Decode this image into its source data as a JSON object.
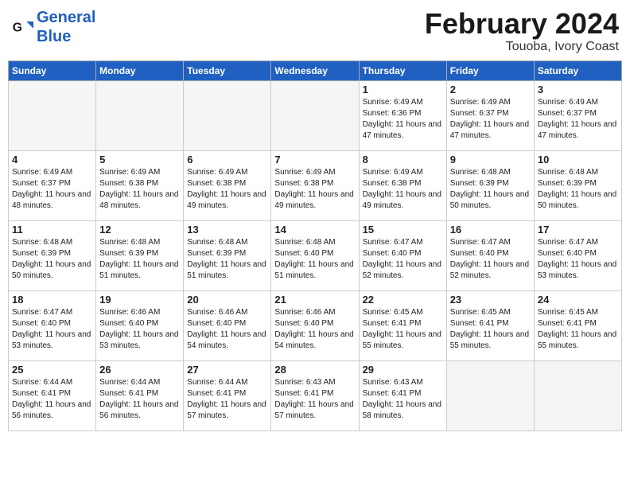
{
  "header": {
    "logo_text_general": "General",
    "logo_text_blue": "Blue",
    "month_year": "February 2024",
    "location": "Touoba, Ivory Coast"
  },
  "weekdays": [
    "Sunday",
    "Monday",
    "Tuesday",
    "Wednesday",
    "Thursday",
    "Friday",
    "Saturday"
  ],
  "weeks": [
    [
      {
        "day": "",
        "empty": true
      },
      {
        "day": "",
        "empty": true
      },
      {
        "day": "",
        "empty": true
      },
      {
        "day": "",
        "empty": true
      },
      {
        "day": "1",
        "sunrise": "Sunrise: 6:49 AM",
        "sunset": "Sunset: 6:36 PM",
        "daylight": "Daylight: 11 hours and 47 minutes."
      },
      {
        "day": "2",
        "sunrise": "Sunrise: 6:49 AM",
        "sunset": "Sunset: 6:37 PM",
        "daylight": "Daylight: 11 hours and 47 minutes."
      },
      {
        "day": "3",
        "sunrise": "Sunrise: 6:49 AM",
        "sunset": "Sunset: 6:37 PM",
        "daylight": "Daylight: 11 hours and 47 minutes."
      }
    ],
    [
      {
        "day": "4",
        "sunrise": "Sunrise: 6:49 AM",
        "sunset": "Sunset: 6:37 PM",
        "daylight": "Daylight: 11 hours and 48 minutes."
      },
      {
        "day": "5",
        "sunrise": "Sunrise: 6:49 AM",
        "sunset": "Sunset: 6:38 PM",
        "daylight": "Daylight: 11 hours and 48 minutes."
      },
      {
        "day": "6",
        "sunrise": "Sunrise: 6:49 AM",
        "sunset": "Sunset: 6:38 PM",
        "daylight": "Daylight: 11 hours and 49 minutes."
      },
      {
        "day": "7",
        "sunrise": "Sunrise: 6:49 AM",
        "sunset": "Sunset: 6:38 PM",
        "daylight": "Daylight: 11 hours and 49 minutes."
      },
      {
        "day": "8",
        "sunrise": "Sunrise: 6:49 AM",
        "sunset": "Sunset: 6:38 PM",
        "daylight": "Daylight: 11 hours and 49 minutes."
      },
      {
        "day": "9",
        "sunrise": "Sunrise: 6:48 AM",
        "sunset": "Sunset: 6:39 PM",
        "daylight": "Daylight: 11 hours and 50 minutes."
      },
      {
        "day": "10",
        "sunrise": "Sunrise: 6:48 AM",
        "sunset": "Sunset: 6:39 PM",
        "daylight": "Daylight: 11 hours and 50 minutes."
      }
    ],
    [
      {
        "day": "11",
        "sunrise": "Sunrise: 6:48 AM",
        "sunset": "Sunset: 6:39 PM",
        "daylight": "Daylight: 11 hours and 50 minutes."
      },
      {
        "day": "12",
        "sunrise": "Sunrise: 6:48 AM",
        "sunset": "Sunset: 6:39 PM",
        "daylight": "Daylight: 11 hours and 51 minutes."
      },
      {
        "day": "13",
        "sunrise": "Sunrise: 6:48 AM",
        "sunset": "Sunset: 6:39 PM",
        "daylight": "Daylight: 11 hours and 51 minutes."
      },
      {
        "day": "14",
        "sunrise": "Sunrise: 6:48 AM",
        "sunset": "Sunset: 6:40 PM",
        "daylight": "Daylight: 11 hours and 51 minutes."
      },
      {
        "day": "15",
        "sunrise": "Sunrise: 6:47 AM",
        "sunset": "Sunset: 6:40 PM",
        "daylight": "Daylight: 11 hours and 52 minutes."
      },
      {
        "day": "16",
        "sunrise": "Sunrise: 6:47 AM",
        "sunset": "Sunset: 6:40 PM",
        "daylight": "Daylight: 11 hours and 52 minutes."
      },
      {
        "day": "17",
        "sunrise": "Sunrise: 6:47 AM",
        "sunset": "Sunset: 6:40 PM",
        "daylight": "Daylight: 11 hours and 53 minutes."
      }
    ],
    [
      {
        "day": "18",
        "sunrise": "Sunrise: 6:47 AM",
        "sunset": "Sunset: 6:40 PM",
        "daylight": "Daylight: 11 hours and 53 minutes."
      },
      {
        "day": "19",
        "sunrise": "Sunrise: 6:46 AM",
        "sunset": "Sunset: 6:40 PM",
        "daylight": "Daylight: 11 hours and 53 minutes."
      },
      {
        "day": "20",
        "sunrise": "Sunrise: 6:46 AM",
        "sunset": "Sunset: 6:40 PM",
        "daylight": "Daylight: 11 hours and 54 minutes."
      },
      {
        "day": "21",
        "sunrise": "Sunrise: 6:46 AM",
        "sunset": "Sunset: 6:40 PM",
        "daylight": "Daylight: 11 hours and 54 minutes."
      },
      {
        "day": "22",
        "sunrise": "Sunrise: 6:45 AM",
        "sunset": "Sunset: 6:41 PM",
        "daylight": "Daylight: 11 hours and 55 minutes."
      },
      {
        "day": "23",
        "sunrise": "Sunrise: 6:45 AM",
        "sunset": "Sunset: 6:41 PM",
        "daylight": "Daylight: 11 hours and 55 minutes."
      },
      {
        "day": "24",
        "sunrise": "Sunrise: 6:45 AM",
        "sunset": "Sunset: 6:41 PM",
        "daylight": "Daylight: 11 hours and 55 minutes."
      }
    ],
    [
      {
        "day": "25",
        "sunrise": "Sunrise: 6:44 AM",
        "sunset": "Sunset: 6:41 PM",
        "daylight": "Daylight: 11 hours and 56 minutes."
      },
      {
        "day": "26",
        "sunrise": "Sunrise: 6:44 AM",
        "sunset": "Sunset: 6:41 PM",
        "daylight": "Daylight: 11 hours and 56 minutes."
      },
      {
        "day": "27",
        "sunrise": "Sunrise: 6:44 AM",
        "sunset": "Sunset: 6:41 PM",
        "daylight": "Daylight: 11 hours and 57 minutes."
      },
      {
        "day": "28",
        "sunrise": "Sunrise: 6:43 AM",
        "sunset": "Sunset: 6:41 PM",
        "daylight": "Daylight: 11 hours and 57 minutes."
      },
      {
        "day": "29",
        "sunrise": "Sunrise: 6:43 AM",
        "sunset": "Sunset: 6:41 PM",
        "daylight": "Daylight: 11 hours and 58 minutes."
      },
      {
        "day": "",
        "empty": true
      },
      {
        "day": "",
        "empty": true
      }
    ]
  ]
}
